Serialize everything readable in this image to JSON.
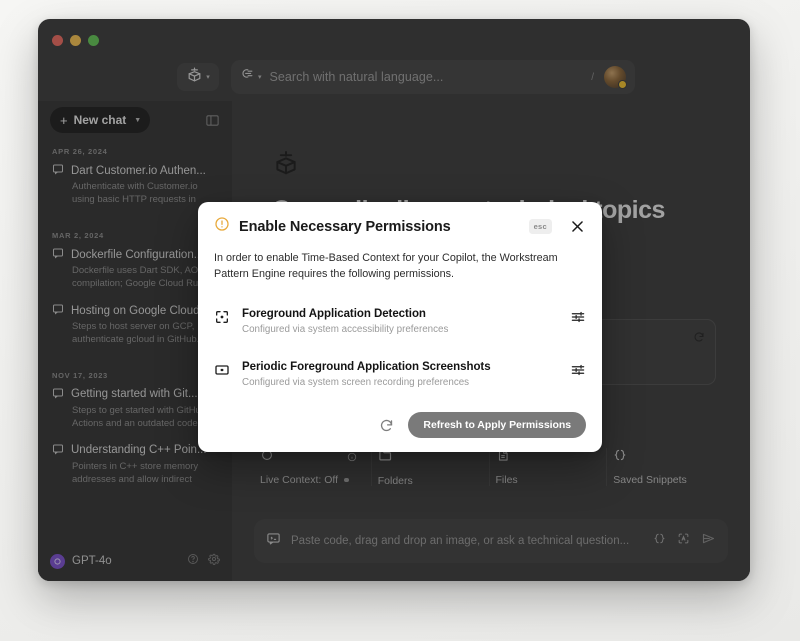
{
  "window": {
    "traffic_lights": [
      "close",
      "minimize",
      "maximize"
    ],
    "colors": {
      "accent_purple": "#7b4fcf",
      "warning_amber": "#e8a93a",
      "window_bg": "#3a3a3a",
      "sidebar_bg": "#333333",
      "modal_bg": "#ffffff",
      "primary_button": "#7a7a7a"
    }
  },
  "topbar": {
    "model_selector_label": "",
    "search_mode_label": "",
    "search_placeholder": "Search with natural language...",
    "shortcut_key": "/"
  },
  "sidebar": {
    "new_chat_label": "New chat",
    "groups": [
      {
        "date": "APR 26, 2024",
        "items": [
          {
            "title": "Dart Customer.io Authen...",
            "preview": "Authenticate with Customer.io using basic HTTP requests in Dart."
          }
        ]
      },
      {
        "date": "MAR 2, 2024",
        "items": [
          {
            "title": "Dockerfile Configuration...",
            "preview": "Dockerfile uses Dart SDK, AOT compilation; Google Cloud Run en..."
          },
          {
            "title": "Hosting on Google Cloud",
            "preview": "Steps to host server on GCP, authenticate gcloud in GitHub."
          }
        ]
      },
      {
        "date": "NOV 17, 2023",
        "items": [
          {
            "title": "Getting started with Git...",
            "preview": "Steps to get started with GitHub Actions and an outdated code snip..."
          },
          {
            "title": "Understanding C++ Poin...",
            "preview": "Pointers in C++ store memory addresses and allow indirect manipul..."
          }
        ]
      }
    ],
    "footer": {
      "model_name": "GPT-4o"
    }
  },
  "main": {
    "heading": "Generally discuss technical topics",
    "actions": [
      {
        "label": "Live Context: Off",
        "has_status_dot": true,
        "has_info_icon": true
      },
      {
        "label": "Folders",
        "has_status_dot": false,
        "has_info_icon": false
      },
      {
        "label": "Files",
        "has_status_dot": false,
        "has_info_icon": false
      },
      {
        "label": "Saved Snippets",
        "has_status_dot": false,
        "has_info_icon": false
      }
    ],
    "composer_placeholder": "Paste code, drag and drop an image, or ask a technical question..."
  },
  "modal": {
    "title": "Enable Necessary Permissions",
    "esc_badge": "esc",
    "body": "In order to enable Time-Based Context for your Copilot, the Workstream Pattern Engine requires the following permissions.",
    "permissions": [
      {
        "name": "Foreground Application Detection",
        "description": "Configured via system accessibility preferences"
      },
      {
        "name": "Periodic Foreground Application Screenshots",
        "description": "Configured via system screen recording preferences"
      }
    ],
    "primary_button": "Refresh to Apply Permissions"
  }
}
